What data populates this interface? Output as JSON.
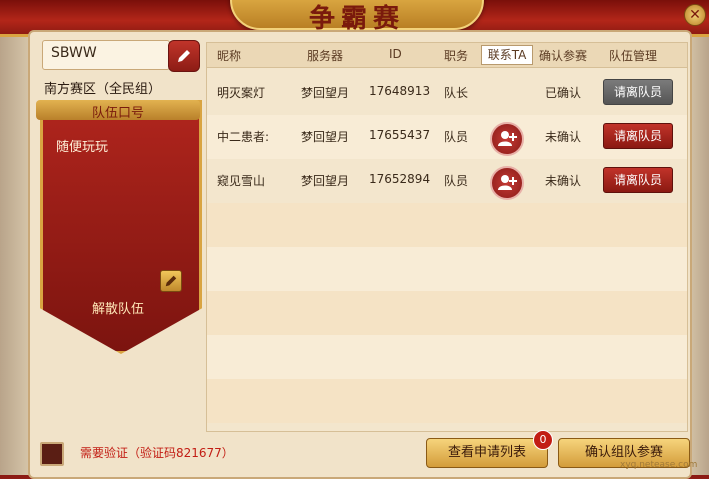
{
  "header": {
    "title": "争霸赛",
    "close_icon": "close-icon"
  },
  "team": {
    "name": "SBWW",
    "region": "南方赛区（全民组）",
    "slogan_title": "队伍口号",
    "slogan": "随便玩玩",
    "disband_label": "解散队伍"
  },
  "table": {
    "headers": [
      "昵称",
      "服务器",
      "ID",
      "职务",
      "联系TA",
      "确认参赛",
      "队伍管理"
    ],
    "rows": [
      {
        "nickname": "明灭案灯",
        "server": "梦回望月",
        "id": "17648913",
        "role": "队长",
        "contact": false,
        "status": "已确认",
        "action": "请离队员",
        "action_state": "disabled"
      },
      {
        "nickname": "中二患者:",
        "server": "梦回望月",
        "id": "17655437",
        "role": "队员",
        "contact": true,
        "status": "未确认",
        "action": "请离队员",
        "action_state": "active"
      },
      {
        "nickname": "窥见雪山",
        "server": "梦回望月",
        "id": "17652894",
        "role": "队员",
        "contact": true,
        "status": "未确认",
        "action": "请离队员",
        "action_state": "active"
      }
    ]
  },
  "footer": {
    "verify_text": "需要验证（验证码821677）",
    "apply_list_label": "查看申请列表",
    "apply_count": "0",
    "confirm_label": "确认组队参赛",
    "watermark": "xyq.netease.com"
  },
  "colors": {
    "accent_red": "#b32619",
    "gold": "#d9a441",
    "panel": "#f1e3c9"
  }
}
